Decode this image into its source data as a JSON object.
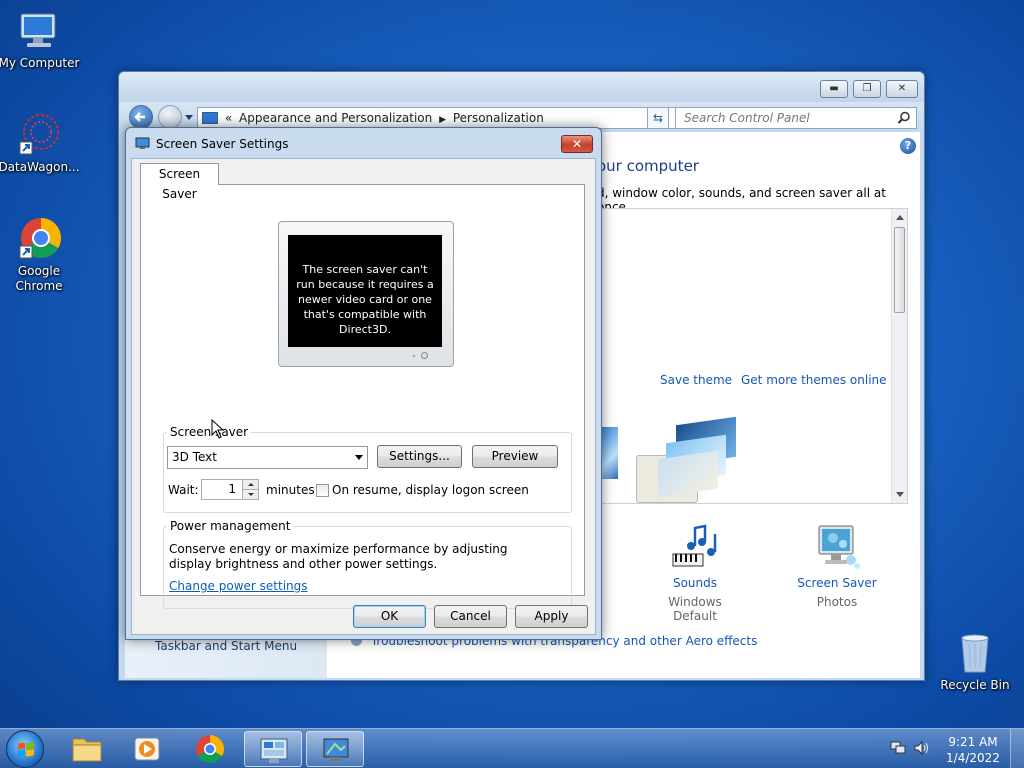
{
  "desktop": {
    "icons": [
      {
        "label": "My Computer"
      },
      {
        "label": "DataWagon..."
      },
      {
        "label": "Google Chrome"
      },
      {
        "label": "Recycle Bin"
      }
    ]
  },
  "control_panel": {
    "breadcrumb": {
      "separator": "«",
      "parts": [
        "Appearance and Personalization",
        "Personalization"
      ]
    },
    "search_placeholder": "Search Control Panel",
    "heading_partial": "our computer",
    "description_partial": "d, window color, sounds, and screen saver all at once.",
    "save_theme": "Save theme",
    "get_more_themes": "Get more themes online",
    "sounds": {
      "label": "Sounds",
      "value": "Windows Default"
    },
    "screen_saver": {
      "label": "Screen Saver",
      "value": "Photos"
    },
    "sidebar_link": "Taskbar and Start Menu",
    "aero_link": "Troubleshoot problems with transparency and other Aero effects"
  },
  "dialog": {
    "title": "Screen Saver Settings",
    "close": "✕",
    "tab": "Screen Saver",
    "preview_message": "The screen saver can't run because it requires a newer video card or one that's compatible with Direct3D.",
    "screen_saver_group": "Screen saver",
    "selected_screen_saver": "3D Text",
    "settings_button": "Settings...",
    "preview_button": "Preview",
    "wait_label": "Wait:",
    "wait_value": "1",
    "minutes_label": "minutes",
    "on_resume_label": "On resume, display logon screen",
    "on_resume_checked": false,
    "power_group": "Power management",
    "power_text": "Conserve energy or maximize performance by adjusting display brightness and other power settings.",
    "power_link": "Change power settings",
    "ok": "OK",
    "cancel": "Cancel",
    "apply": "Apply"
  },
  "taskbar": {
    "time": "9:21 AM",
    "date": "1/4/2022"
  }
}
